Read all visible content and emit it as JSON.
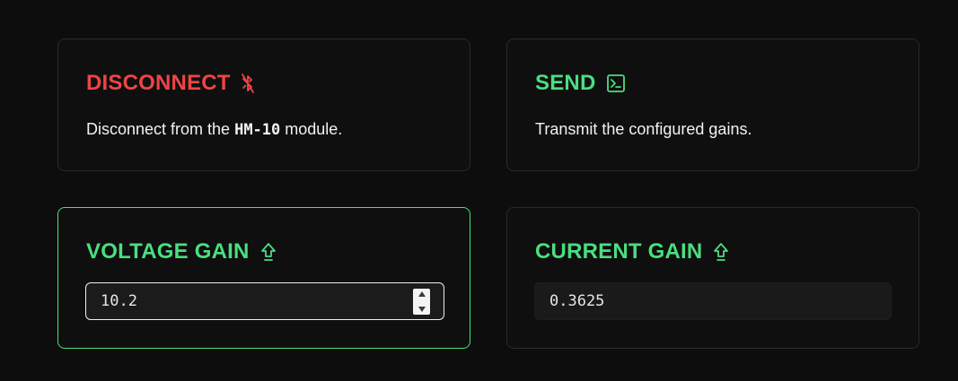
{
  "cards": {
    "disconnect": {
      "title": "DISCONNECT",
      "icon": "bluetooth-off-icon",
      "desc_before": "Disconnect from the ",
      "desc_code": "HM-10",
      "desc_after": " module.",
      "color": "#ef4444"
    },
    "send": {
      "title": "SEND",
      "icon": "terminal-icon",
      "desc": "Transmit the configured gains.",
      "color": "#4ade80"
    },
    "voltage_gain": {
      "title": "VOLTAGE GAIN",
      "icon": "arrow-up-outline-icon",
      "value": "10.2",
      "color": "#4ade80"
    },
    "current_gain": {
      "title": "CURRENT GAIN",
      "icon": "arrow-up-outline-icon",
      "value": "0.3625",
      "color": "#4ade80"
    }
  },
  "colors": {
    "background": "#0d0d0d",
    "accent_green": "#4ade80",
    "accent_red": "#ef4444"
  }
}
